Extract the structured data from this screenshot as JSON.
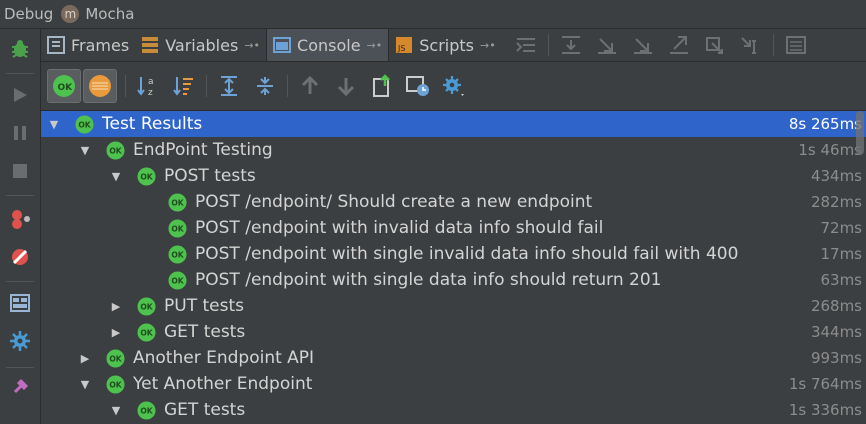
{
  "title": {
    "debug": "Debug",
    "badge": "m",
    "config": "Mocha"
  },
  "tabs": [
    {
      "label": "Frames"
    },
    {
      "label": "Variables"
    },
    {
      "label": "Console"
    },
    {
      "label": "Scripts"
    }
  ],
  "colors": {
    "selection": "#2f65ca",
    "ok": "#4ec14e",
    "background": "#3c3f41"
  },
  "tree": [
    {
      "label": "Test Results",
      "duration": "8s 265ms",
      "expanded": true
    },
    {
      "label": "EndPoint Testing",
      "duration": "1s 46ms",
      "expanded": true
    },
    {
      "label": "POST tests",
      "duration": "434ms",
      "expanded": true
    },
    {
      "label": "POST /endpoint/ Should create a new endpoint",
      "duration": "282ms"
    },
    {
      "label": "POST /endpoint with invalid data info should fail",
      "duration": "72ms"
    },
    {
      "label": "POST /endpoint with single invalid data info should fail with 400",
      "duration": "17ms"
    },
    {
      "label": "POST /endpoint with single data info should return 201",
      "duration": "63ms"
    },
    {
      "label": "PUT tests",
      "duration": "268ms",
      "expanded": false
    },
    {
      "label": "GET tests",
      "duration": "344ms",
      "expanded": false
    },
    {
      "label": "Another Endpoint API",
      "duration": "993ms",
      "expanded": false
    },
    {
      "label": "Yet Another Endpoint",
      "duration": "1s 764ms",
      "expanded": true
    },
    {
      "label": "GET tests",
      "duration": "1s 336ms",
      "expanded": true
    }
  ],
  "ok_badge": "OK"
}
